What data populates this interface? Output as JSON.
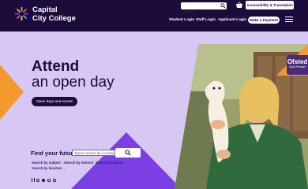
{
  "header": {
    "logo_line1": "Capital",
    "logo_line2": "City College",
    "search_placeholder": "Search",
    "accessibility_label": "Accessibility & Translation",
    "links": [
      "Student Login",
      "Staff Login",
      "Applicant Login"
    ],
    "payment_label": "Make a Payment"
  },
  "hero": {
    "title_bold": "Attend",
    "title_rest": "an open day",
    "cta_label": "Open days and events"
  },
  "ofsted": {
    "title": "Ofsted",
    "subtitle": "Good Provider"
  },
  "finder": {
    "title": "Find your future",
    "input_placeholder": "Type to search for a course",
    "links": [
      "Search by subject →",
      "Search by interest →",
      "Search by career →",
      "Search by location →"
    ]
  },
  "carousel": {
    "slide_count": 4,
    "active_slide": 2
  },
  "colors": {
    "navy": "#1b0c3c",
    "lavender": "#d6c8f3",
    "orange": "#f29a2e",
    "purple": "#7b3fe4"
  }
}
